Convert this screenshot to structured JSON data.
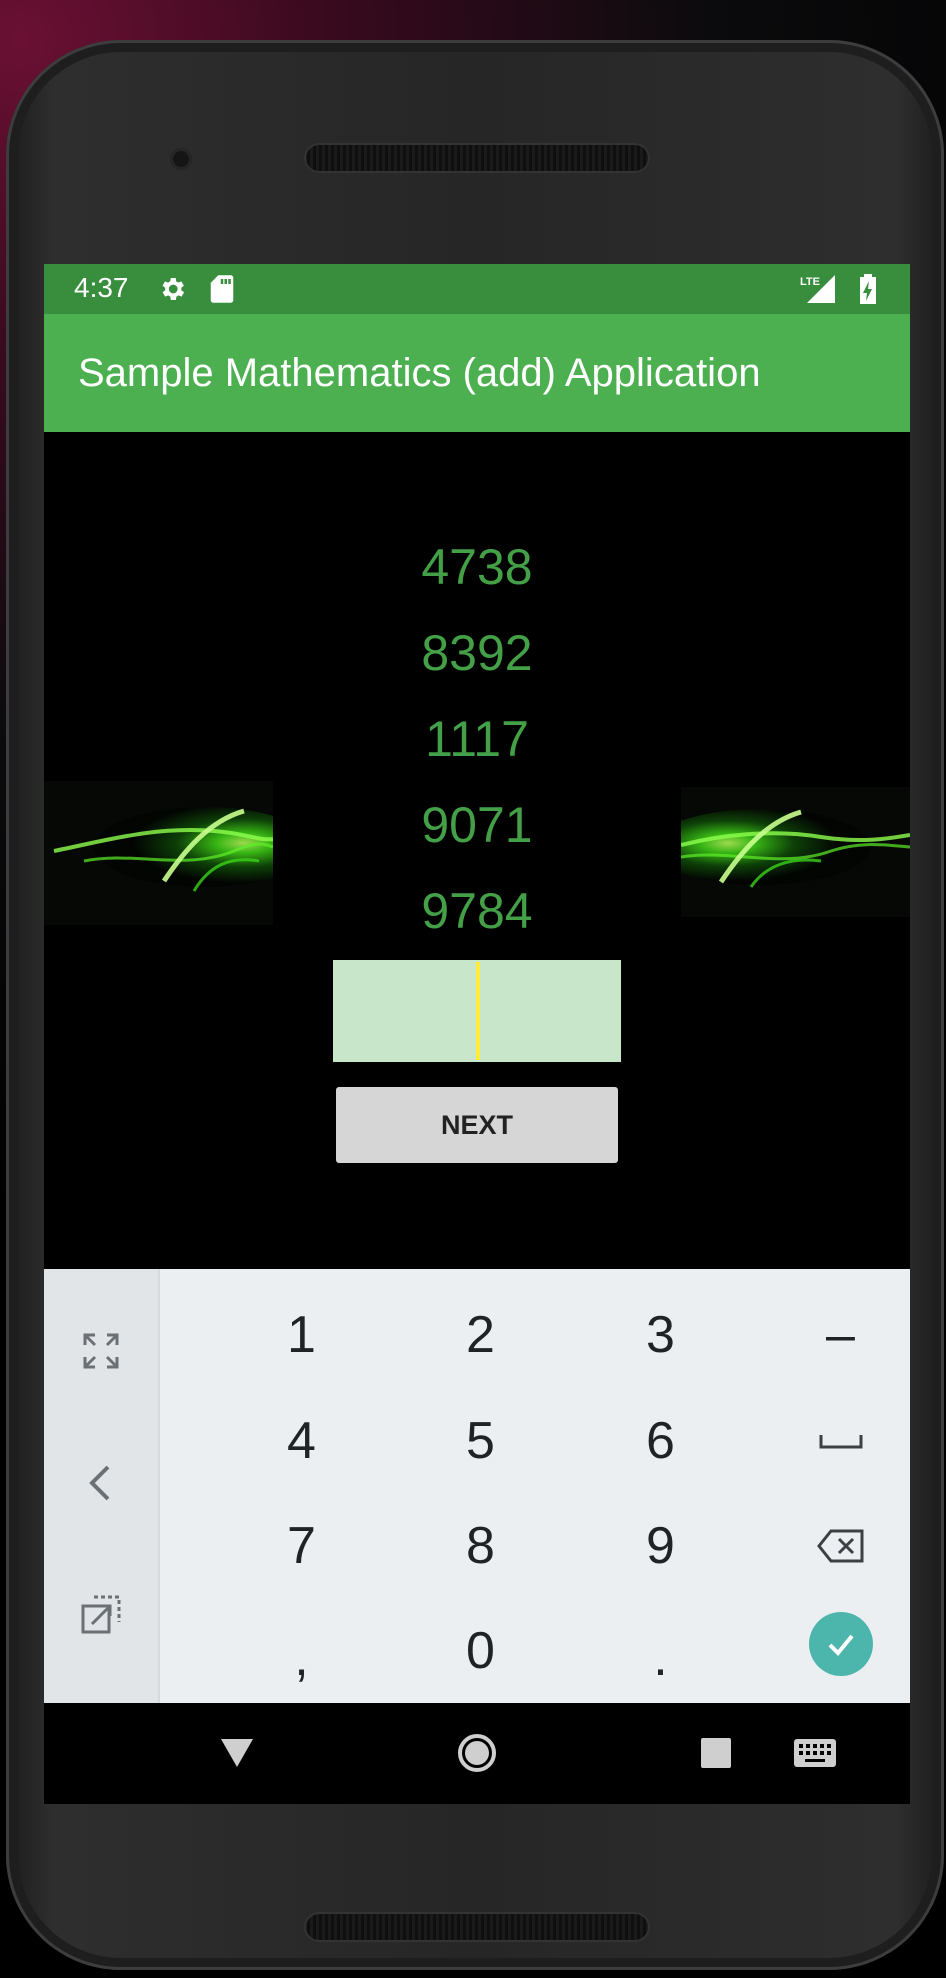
{
  "status_bar": {
    "time": "4:37",
    "icons": [
      "settings-icon",
      "sd-card-icon",
      "lte-signal-icon",
      "battery-charging-icon"
    ],
    "network_label": "LTE"
  },
  "app_bar": {
    "title": "Sample Mathematics (add) Application",
    "color": "#4caf50",
    "status_color": "#388e3c"
  },
  "main": {
    "numbers": [
      "4738",
      "8392",
      "1117",
      "9071",
      "9784"
    ],
    "number_color": "#43a047",
    "answer_value": "",
    "next_label": "NEXT"
  },
  "keyboard": {
    "side_icons": [
      "fullscreen-icon",
      "back-arrow-icon",
      "popout-icon"
    ],
    "rows": [
      [
        "1",
        "2",
        "3",
        "–"
      ],
      [
        "4",
        "5",
        "6",
        "␣"
      ],
      [
        "7",
        "8",
        "9",
        "⌫"
      ],
      [
        ",",
        "0",
        ".",
        "✓"
      ]
    ],
    "enter_color": "#4db6ac"
  },
  "nav_bar": {
    "icons": [
      "back-triangle-icon",
      "home-circle-icon",
      "recents-square-icon",
      "keyboard-icon"
    ]
  }
}
